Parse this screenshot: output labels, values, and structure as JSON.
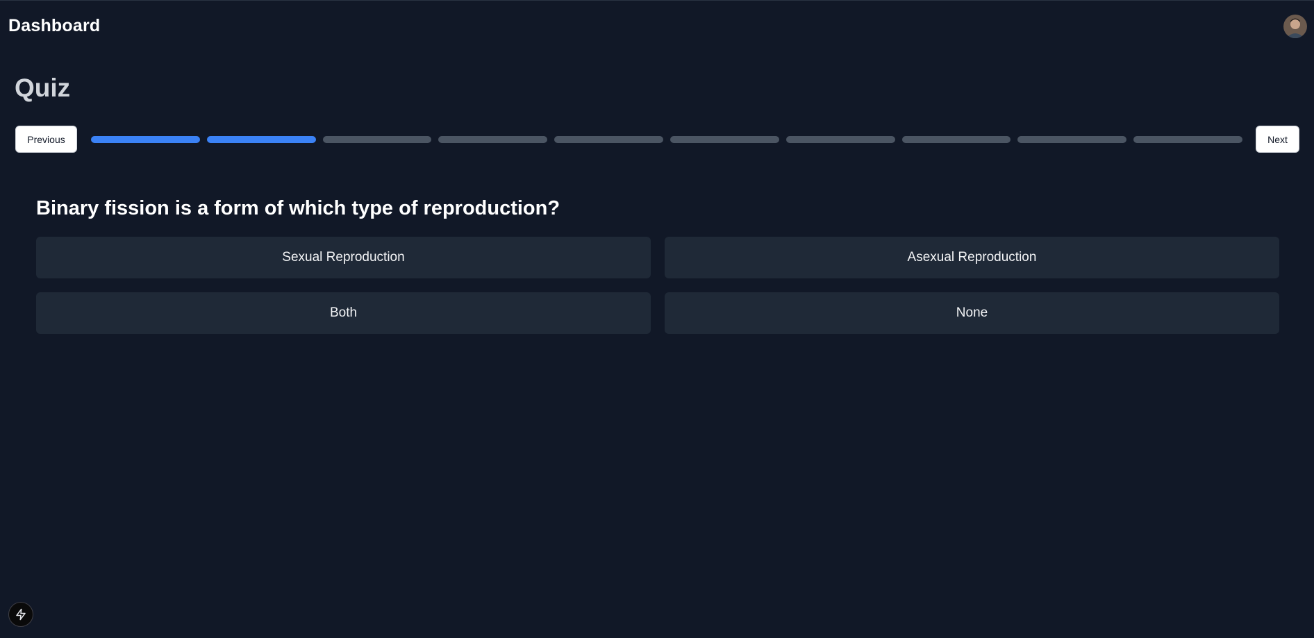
{
  "header": {
    "brand": "Dashboard",
    "avatar_icon": "user-avatar"
  },
  "page": {
    "title": "Quiz"
  },
  "navigation": {
    "previous_label": "Previous",
    "next_label": "Next"
  },
  "progress": {
    "total_steps": 10,
    "completed_steps": 2,
    "done_color": "#3b82f6",
    "pending_color": "#4b5563"
  },
  "question": {
    "text": "Binary fission is a form of which type of reproduction?",
    "options": [
      "Sexual Reproduction",
      "Asexual Reproduction",
      "Both",
      "None"
    ]
  },
  "footer": {
    "icon": "lightning-bolt-icon"
  },
  "colors": {
    "background": "#111827",
    "option_background": "#1f2937",
    "accent": "#3b82f6"
  }
}
